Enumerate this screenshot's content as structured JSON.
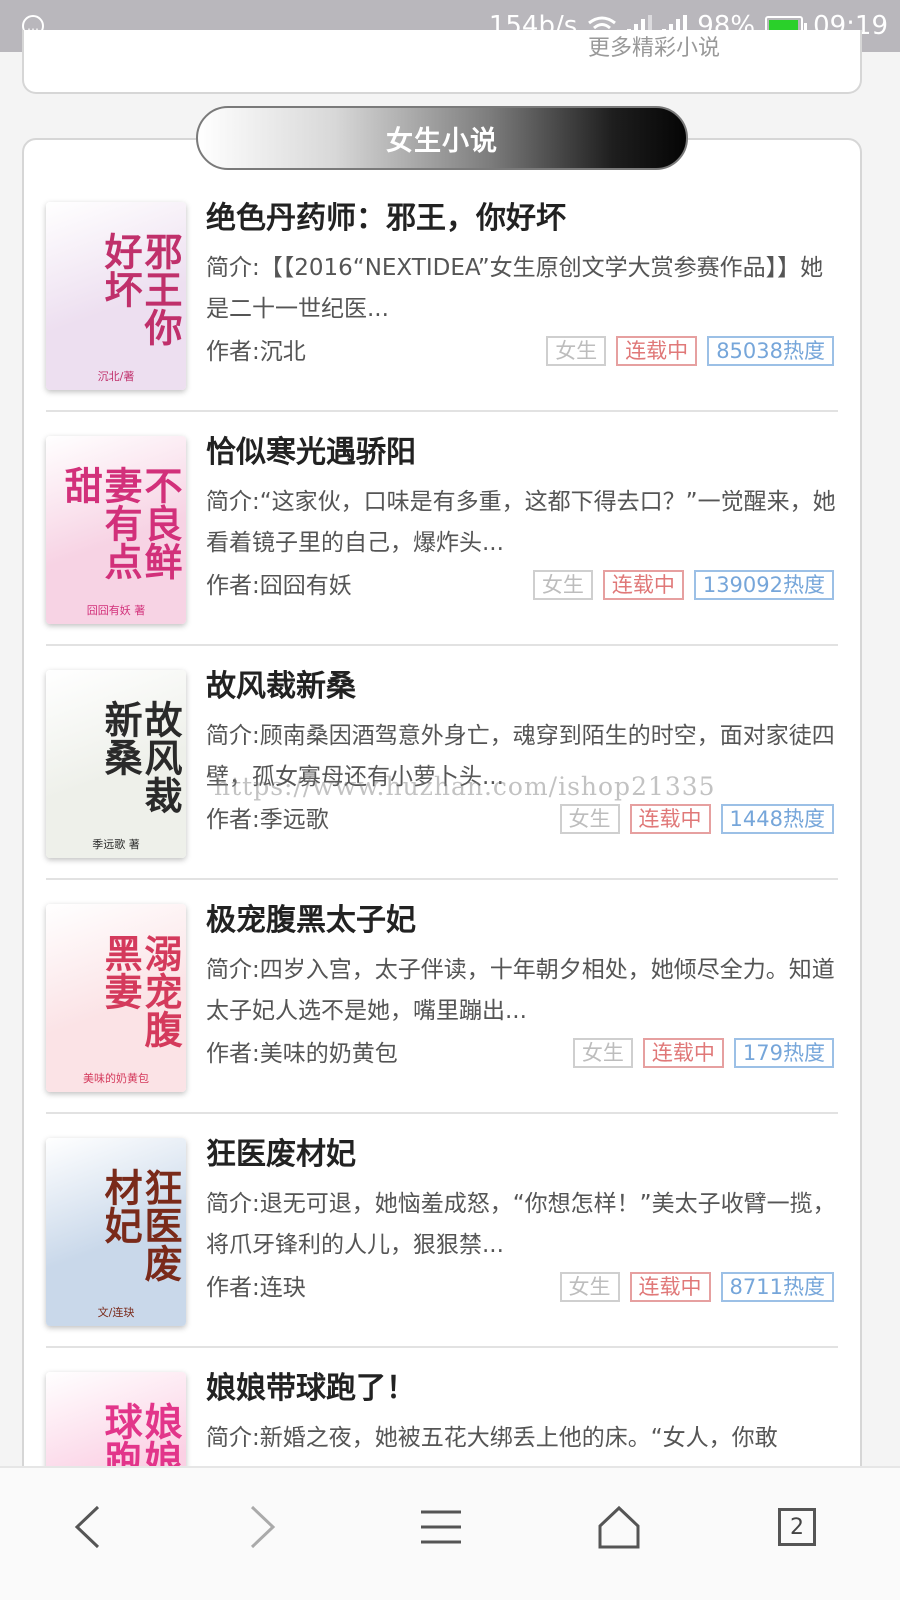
{
  "status_bar": {
    "app_icon_glyph": "…",
    "speed": "154b/s",
    "battery_level": "98%",
    "battery_fraction": 0.98,
    "time": "09:19"
  },
  "prev_section": {
    "more_text": "更多精彩小说"
  },
  "section": {
    "title": "女生小说"
  },
  "books": [
    {
      "title": "绝色丹药师：邪王，你好坏",
      "intro": "简介:【【2016“NEXTIDEA”女生原创文学大赏参赛作品】】她是二十一世纪医...",
      "author": "作者:沉北",
      "tag_gender": "女生",
      "tag_status": "连载中",
      "tag_heat": "85038热度",
      "cover": {
        "text": "邪王你好坏",
        "author": "沉北/著",
        "bg": "#eddff0",
        "fg": "#c0306b"
      }
    },
    {
      "title": "恰似寒光遇骄阳",
      "intro": "简介:“这家伙，口味是有多重，这都下得去口？”一觉醒来，她看着镜子里的自己，爆炸头...",
      "author": "作者:囧囧有妖",
      "tag_gender": "女生",
      "tag_status": "连载中",
      "tag_heat": "139092热度",
      "cover": {
        "text": "不良鲜妻有点甜",
        "author": "囧囧有妖 著",
        "bg": "#f7d3e4",
        "fg": "#d2307a"
      }
    },
    {
      "title": "故风裁新桑",
      "intro": "简介:顾南桑因酒驾意外身亡，魂穿到陌生的时空，面对家徒四壁，孤女寡母还有小萝卜头...",
      "author": "作者:季远歌",
      "tag_gender": "女生",
      "tag_status": "连载中",
      "tag_heat": "1448热度",
      "cover": {
        "text": "故风裁新桑",
        "author": "季远歌 著",
        "bg": "#eef0ea",
        "fg": "#2a2a2a"
      }
    },
    {
      "title": "极宠腹黑太子妃",
      "intro": "简介:四岁入宫，太子伴读，十年朝夕相处，她倾尽全力。知道太子妃人选不是她，嘴里蹦出...",
      "author": "作者:美味的奶黄包",
      "tag_gender": "女生",
      "tag_status": "连载中",
      "tag_heat": "179热度",
      "cover": {
        "text": "溺宠腹黑妻",
        "author": "美味的奶黄包",
        "bg": "#fbe3e6",
        "fg": "#d43a5c"
      }
    },
    {
      "title": "狂医废材妃",
      "intro": "简介:退无可退，她恼羞成怒，“你想怎样！”美太子收臂一揽，将爪牙锋利的人儿，狠狠禁...",
      "author": "作者:连玦",
      "tag_gender": "女生",
      "tag_status": "连载中",
      "tag_heat": "8711热度",
      "cover": {
        "text": "狂医废材妃",
        "author": "文/连玦",
        "bg": "#c9d8ea",
        "fg": "#7a2a1a"
      }
    },
    {
      "title": "娘娘带球跑了！",
      "intro": "简介:新婚之夜，她被五花大绑丢上他的床。“女人，你敢",
      "author": "",
      "tag_gender": "",
      "tag_status": "",
      "tag_heat": "",
      "cover": {
        "text": "娘娘带球跑",
        "author": "",
        "bg": "#fbd0e4",
        "fg": "#e2358a"
      }
    }
  ],
  "watermark": "https://www.huzhan.com/ishop21335",
  "bottom_nav": {
    "tab_count": "2"
  }
}
